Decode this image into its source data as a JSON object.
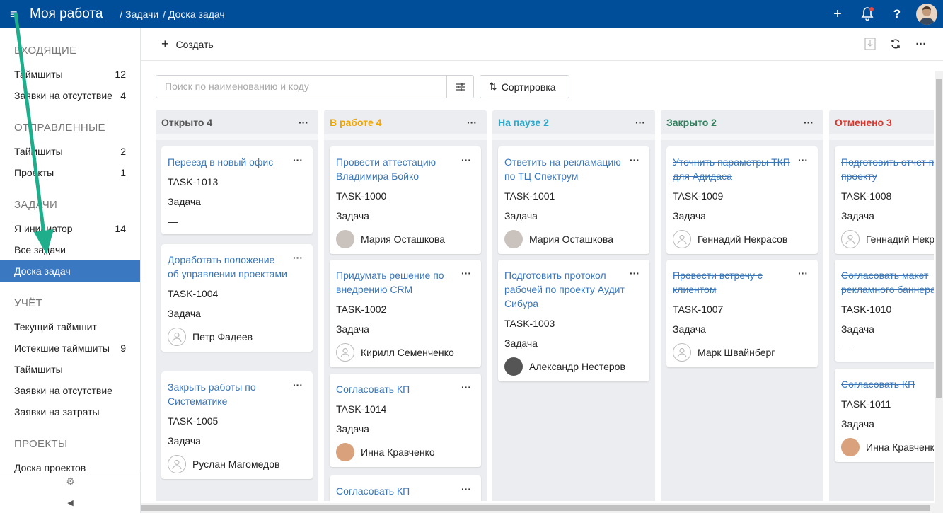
{
  "header": {
    "title": "Моя работа",
    "breadcrumb": [
      "/ Задачи",
      "/ Доска задач"
    ],
    "icons": [
      "menu-icon",
      "plus-icon",
      "bell-icon",
      "help-icon",
      "avatar"
    ]
  },
  "sidebar": {
    "sections": [
      {
        "title": "ВХОДЯЩИЕ",
        "items": [
          {
            "label": "Таймшиты",
            "count": "12"
          },
          {
            "label": "Заявки на отсутствие",
            "count": "4"
          }
        ]
      },
      {
        "title": "ОТПРАВЛЕННЫЕ",
        "items": [
          {
            "label": "Таймшиты",
            "count": "2"
          },
          {
            "label": "Проекты",
            "count": "1"
          }
        ]
      },
      {
        "title": "ЗАДАЧИ",
        "items": [
          {
            "label": "Я инициатор",
            "count": "14"
          },
          {
            "label": "Все задачи",
            "count": ""
          },
          {
            "label": "Доска задач",
            "count": "",
            "active": true
          }
        ]
      },
      {
        "title": "УЧЁТ",
        "items": [
          {
            "label": "Текущий таймшит",
            "count": ""
          },
          {
            "label": "Истекшие таймшиты",
            "count": "9"
          },
          {
            "label": "Таймшиты",
            "count": ""
          },
          {
            "label": "Заявки на отсутствие",
            "count": ""
          },
          {
            "label": "Заявки на затраты",
            "count": ""
          }
        ]
      },
      {
        "title": "ПРОЕКТЫ",
        "items": [
          {
            "label": "Доска проектов",
            "count": ""
          }
        ]
      }
    ]
  },
  "toolbar": {
    "create_label": "Создать"
  },
  "search": {
    "placeholder": "Поиск по наименованию и коду"
  },
  "sort": {
    "label": "Сортировка"
  },
  "colors": {
    "header": "#004d99",
    "active": "#3b78c2",
    "link": "#3a76b8",
    "open": "#555555",
    "in_progress": "#f0a500",
    "paused": "#2aa6c9",
    "closed": "#2e7d5b",
    "cancelled": "#d9342b",
    "arrow": "#1fae8c"
  },
  "columns": [
    {
      "title": "Открыто 4",
      "color": "#555555",
      "cards": [
        {
          "title": "Переезд в новый офис",
          "code": "TASK-1013",
          "type": "Задача",
          "assignee": "—"
        },
        {
          "title": "Доработать положение об управлении проектами",
          "code": "TASK-1004",
          "type": "Задача",
          "assignee": "Петр Фадеев"
        },
        {
          "title": "Закрыть работы по Систематике",
          "code": "TASK-1005",
          "type": "Задача",
          "assignee": "Руслан Магомедов"
        }
      ]
    },
    {
      "title": "В работе 4",
      "color": "#f0a500",
      "cards": [
        {
          "title": "Провести аттестацию Владимира Бойко",
          "code": "TASK-1000",
          "type": "Задача",
          "assignee": "Мария Осташкова"
        },
        {
          "title": "Придумать решение по внедрению CRM",
          "code": "TASK-1002",
          "type": "Задача",
          "assignee": "Кирилл Семенченко"
        },
        {
          "title": "Согласовать КП",
          "code": "TASK-1014",
          "type": "Задача",
          "assignee": "Инна Кравченко"
        },
        {
          "title": "Согласовать КП",
          "code": "",
          "type": "",
          "assignee": ""
        }
      ]
    },
    {
      "title": "На паузе 2",
      "color": "#2aa6c9",
      "cards": [
        {
          "title": "Ответить на рекламацию по ТЦ Спектрум",
          "code": "TASK-1001",
          "type": "Задача",
          "assignee": "Мария Осташкова"
        },
        {
          "title": "Подготовить протокол рабочей по проекту Аудит Сибура",
          "code": "TASK-1003",
          "type": "Задача",
          "assignee": "Александр Нестеров"
        }
      ]
    },
    {
      "title": "Закрыто 2",
      "color": "#2e7d5b",
      "cards": [
        {
          "title": "Уточнить параметры ТКП для Адидаса",
          "code": "TASK-1009",
          "type": "Задача",
          "assignee": "Геннадий Некрасов"
        },
        {
          "title": "Провести встречу с клиентом",
          "code": "TASK-1007",
          "type": "Задача",
          "assignee": "Марк Швайнберг"
        }
      ]
    },
    {
      "title": "Отменено 3",
      "color": "#d9342b",
      "cards": [
        {
          "title": "Подготовить отчет по проекту",
          "code": "TASK-1008",
          "type": "Задача",
          "assignee": "Геннадий Некрасов"
        },
        {
          "title": "Согласовать макет рекламного баннера",
          "code": "TASK-1010",
          "type": "Задача",
          "assignee": "—"
        },
        {
          "title": "Согласовать КП",
          "code": "TASK-1011",
          "type": "Задача",
          "assignee": "Инна Кравченко"
        }
      ]
    }
  ]
}
